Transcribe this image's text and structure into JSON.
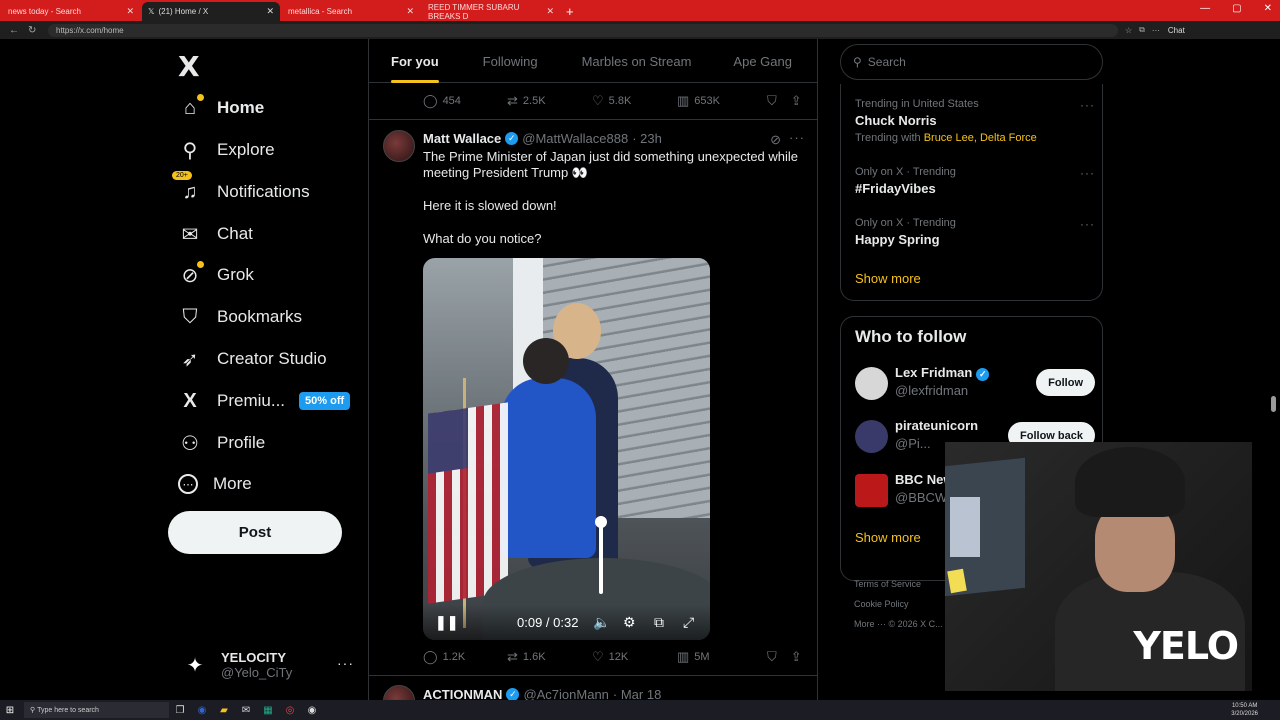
{
  "browser": {
    "tabs": [
      {
        "label": "news today - Search",
        "active": false
      },
      {
        "label": "(21) Home / X",
        "active": true
      },
      {
        "label": "metallica - Search",
        "active": false
      },
      {
        "label": "REED TIMMER SUBARU BREAKS D",
        "active": false
      }
    ],
    "url": "https://x.com/home",
    "chat_label": "Chat"
  },
  "sidebar": {
    "logo": "X",
    "items": [
      {
        "label": "Home",
        "icon": "home-icon",
        "glyph": "⌂",
        "bold": true
      },
      {
        "label": "Explore",
        "icon": "search-icon",
        "glyph": "⚲"
      },
      {
        "label": "Notifications",
        "icon": "bell-icon",
        "glyph": "🔔",
        "badge": "20+"
      },
      {
        "label": "Chat",
        "icon": "mail-icon",
        "glyph": "✉"
      },
      {
        "label": "Grok",
        "icon": "grok-icon",
        "glyph": "⊘"
      },
      {
        "label": "Bookmarks",
        "icon": "bookmark-icon",
        "glyph": "🔖"
      },
      {
        "label": "Creator Studio",
        "icon": "rocket-icon",
        "glyph": "🚀"
      },
      {
        "label": "Premiu...",
        "icon": "x-premium-icon",
        "glyph": "X",
        "badge": "50% off"
      },
      {
        "label": "Profile",
        "icon": "person-icon",
        "glyph": "👤"
      },
      {
        "label": "More",
        "icon": "more-circle-icon",
        "glyph": "⋯"
      }
    ],
    "post_label": "Post",
    "account": {
      "name": "YELOCITY",
      "handle": "@Yelo_CiTy"
    }
  },
  "feed": {
    "tabs": [
      "For you",
      "Following",
      "Marbles on Stream",
      "Ape Gang"
    ],
    "prev_actions": {
      "replies": "454",
      "reposts": "2.5K",
      "likes": "5.8K",
      "views": "653K"
    },
    "tweet": {
      "name": "Matt Wallace",
      "handle": "@MattWallace888",
      "time": "· 23h",
      "line1": "The Prime Minister of Japan just did something unexpected while meeting President Trump 👀",
      "line2": "Here it is slowed down!",
      "line3": "What do you notice?",
      "video_time": "0:09 / 0:32",
      "actions": {
        "replies": "1.2K",
        "reposts": "1.6K",
        "likes": "12K",
        "views": "5M"
      }
    },
    "next_tweet": {
      "name": "ACTIONMAN",
      "handle": "@Ac7ionMann",
      "time": "· Mar 18"
    }
  },
  "right": {
    "search_placeholder": "Search",
    "trends": [
      {
        "meta": "Trending in United States",
        "title": "Chuck Norris",
        "sub_prefix": "Trending with",
        "sub_links": "Bruce Lee, Delta Force"
      },
      {
        "meta": "Only on X · Trending",
        "title": "#FridayVibes"
      },
      {
        "meta": "Only on X · Trending",
        "title": "Happy Spring"
      }
    ],
    "show_more": "Show more",
    "who_to_follow": {
      "title": "Who to follow",
      "people": [
        {
          "name": "Lex Fridman",
          "handle": "@lexfridman",
          "button": "Follow",
          "verified": true
        },
        {
          "name": "pirateunicorn",
          "handle": "@Pi...",
          "button": "Follow back"
        },
        {
          "name": "BBC News",
          "handle": "@BBCW..."
        }
      ],
      "show_more": "Show more"
    },
    "footer": {
      "l1": "Terms of Service",
      "l2": "Cookie Policy",
      "l3": "More ··· © 2026 X C..."
    }
  },
  "overlay": {
    "brand": "YELO"
  },
  "taskbar": {
    "search_placeholder": "Type here to search",
    "time": "10:50 AM",
    "date": "3/20/2026"
  },
  "colors": {
    "accent": "#f4c21a",
    "verified": "#1d9bf0",
    "chrome_tabbar": "#d31c1c"
  }
}
